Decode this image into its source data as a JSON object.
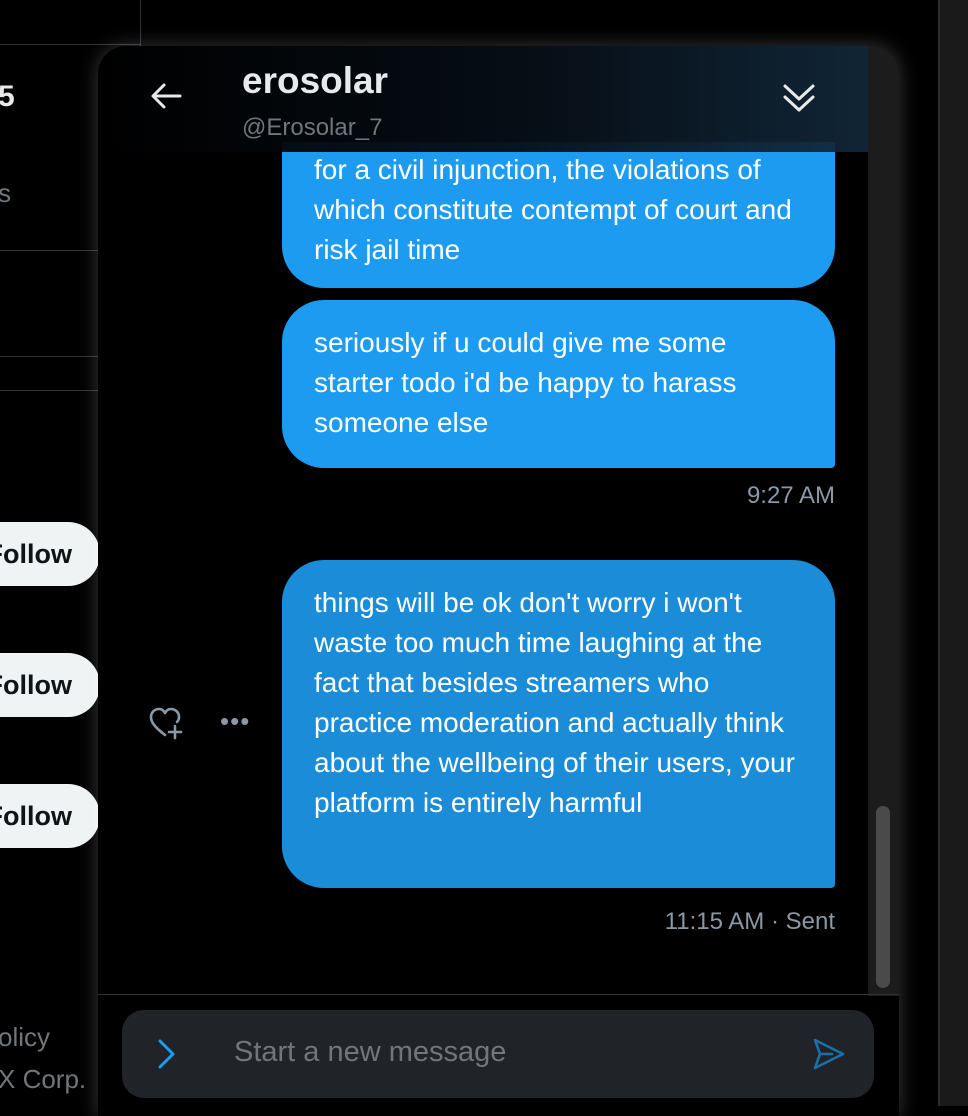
{
  "background": {
    "count_text": "5",
    "subtext": "s",
    "follow_buttons": [
      "Follow",
      "Follow",
      "Follow"
    ],
    "footer_line1": "olicy",
    "footer_line2": "X Corp."
  },
  "header": {
    "name": "erosolar",
    "handle": "@Erosolar_7"
  },
  "messages": [
    {
      "text": "for a civil injunction, the violations of which constitute contempt of court and risk jail time"
    },
    {
      "text": "seriously if u could give me some starter todo i'd be happy to harass someone else"
    },
    {
      "text": "things will be ok don't worry i won't waste too much time laughing at the fact that besides streamers who practice moderation and actually think about the wellbeing of their users, your platform is entirely harmful"
    }
  ],
  "timestamps": {
    "group1": "9:27 AM",
    "group2": "11:15 AM · Sent"
  },
  "composer": {
    "placeholder": "Start a new message"
  },
  "colors": {
    "bubble": "#1d9bf0",
    "bubble_hover": "#1a8cd8",
    "background": "#000000",
    "muted": "#71767b"
  }
}
